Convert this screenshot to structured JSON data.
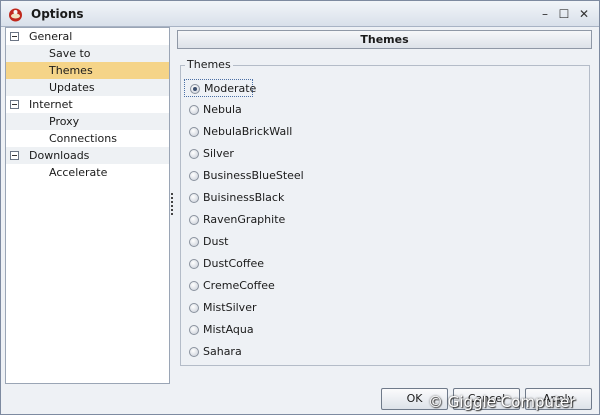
{
  "window": {
    "title": "Options",
    "minimize_glyph": "–",
    "maximize_glyph": "☐",
    "close_glyph": "✕"
  },
  "tree": {
    "items": [
      {
        "label": "General",
        "level": 0,
        "expanded": true
      },
      {
        "label": "Save to",
        "level": 1
      },
      {
        "label": "Themes",
        "level": 1,
        "selected": true
      },
      {
        "label": "Updates",
        "level": 1
      },
      {
        "label": "Internet",
        "level": 0,
        "expanded": true
      },
      {
        "label": "Proxy",
        "level": 1
      },
      {
        "label": "Connections",
        "level": 1
      },
      {
        "label": "Downloads",
        "level": 0,
        "expanded": true
      },
      {
        "label": "Accelerate",
        "level": 1
      }
    ]
  },
  "panel": {
    "header": "Themes",
    "group_label": "Themes"
  },
  "themes": {
    "selected": "Moderate",
    "options": [
      "Moderate",
      "Nebula",
      "NebulaBrickWall",
      "Silver",
      "BusinessBlueSteel",
      "BuisinessBlack",
      "RavenGraphite",
      "Dust",
      "DustCoffee",
      "CremeCoffee",
      "MistSilver",
      "MistAqua",
      "Sahara"
    ]
  },
  "buttons": {
    "ok": "OK",
    "cancel": "Cancel",
    "apply": "Apply"
  },
  "watermark": "© Giggle Computer",
  "colors": {
    "selection": "#f5d488",
    "header": "#dde2e9"
  },
  "icons": {
    "app": "app-logo-icon",
    "expander": "collapse-minus-icon"
  }
}
